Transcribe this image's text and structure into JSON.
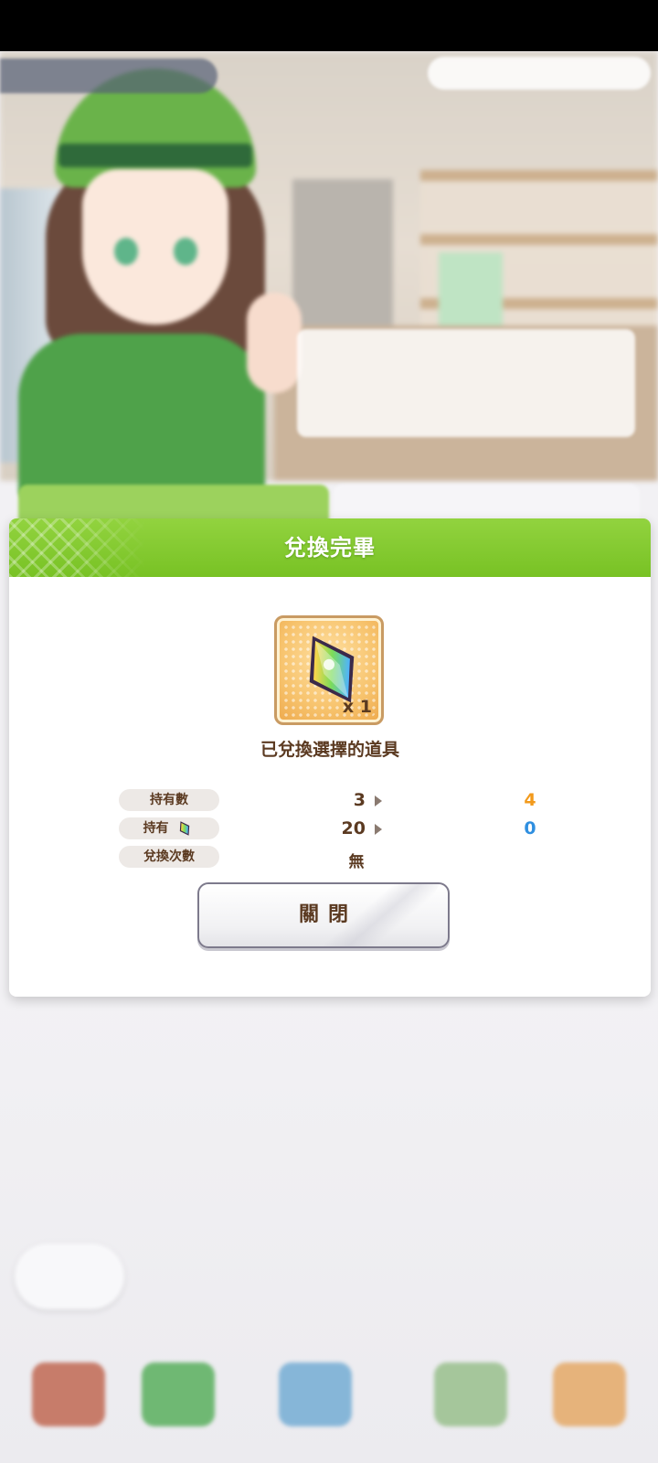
{
  "dialog": {
    "title": "兌換完畢",
    "item": {
      "quantity": "x 1",
      "icon": "rainbow-gem-icon"
    },
    "message": "已兌換選擇的道具",
    "stats": [
      {
        "label": "持有數",
        "from": "3",
        "to": "4",
        "to_color": "#f29a1c"
      },
      {
        "label": "持有",
        "label_icon": "rainbow-gem-icon",
        "from": "20",
        "to": "0",
        "to_color": "#2f8fe0"
      },
      {
        "label": "兌換次數",
        "value": "無"
      }
    ],
    "close_label": "關閉"
  },
  "colors": {
    "header_green": "#78c224",
    "text_brown": "#5b3a21",
    "accent_orange": "#f29a1c",
    "accent_blue": "#2f8fe0"
  }
}
